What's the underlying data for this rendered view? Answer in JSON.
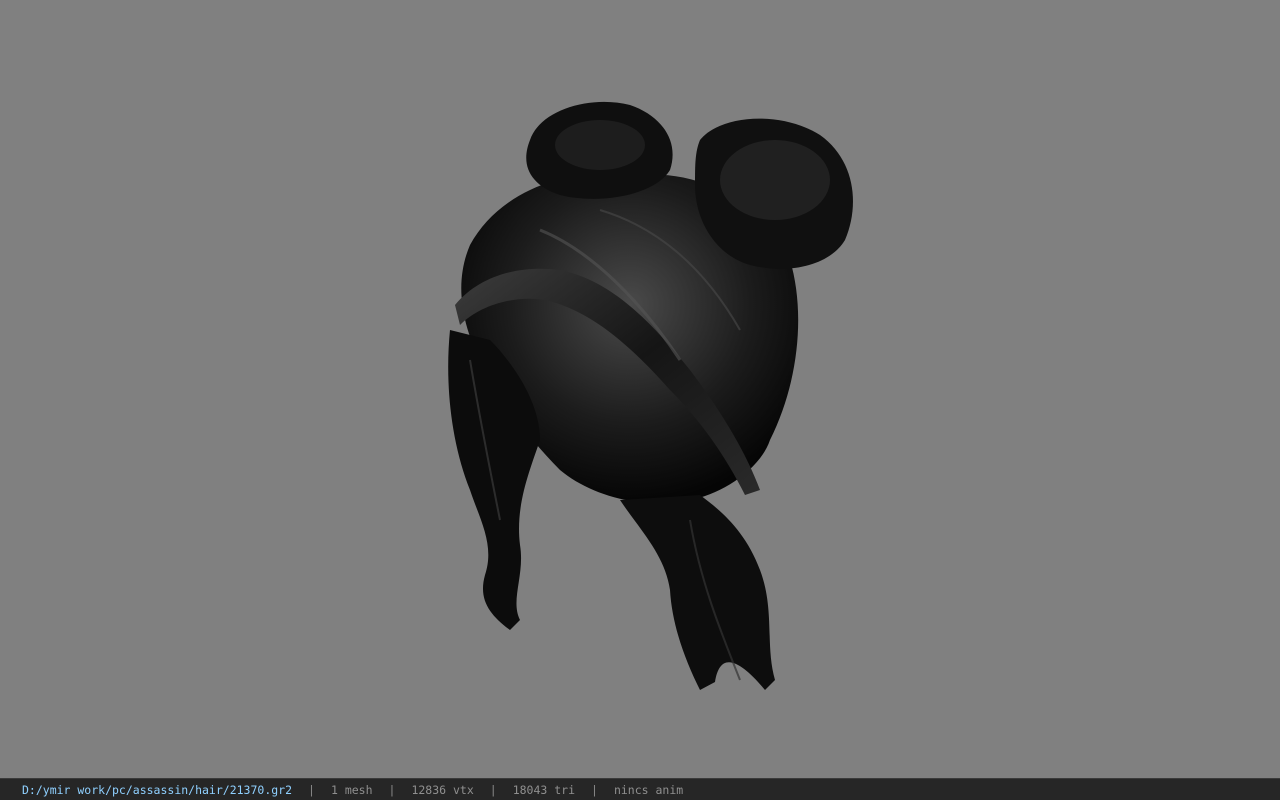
{
  "viewer": {
    "background_color": "#808080",
    "model_color": "#111111",
    "model_description_icon": "hair-mesh-model"
  },
  "status": {
    "path": "D:/ymir work/pc/assassin/hair/21370.gr2",
    "separator": "|",
    "meshes": "1 mesh",
    "vertices": "12836 vtx",
    "triangles": "18043 tri",
    "animation": "nincs anim",
    "path_color": "#8fd0ff",
    "text_color": "#8f8f8f"
  }
}
